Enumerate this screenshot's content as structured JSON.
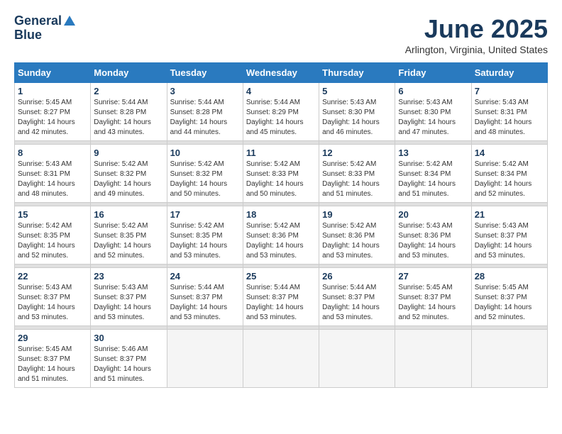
{
  "header": {
    "logo_line1": "General",
    "logo_line2": "Blue",
    "month": "June 2025",
    "location": "Arlington, Virginia, United States"
  },
  "days_of_week": [
    "Sunday",
    "Monday",
    "Tuesday",
    "Wednesday",
    "Thursday",
    "Friday",
    "Saturday"
  ],
  "weeks": [
    [
      {
        "day": "1",
        "sunrise": "5:45 AM",
        "sunset": "8:27 PM",
        "daylight": "14 hours and 42 minutes."
      },
      {
        "day": "2",
        "sunrise": "5:44 AM",
        "sunset": "8:28 PM",
        "daylight": "14 hours and 43 minutes."
      },
      {
        "day": "3",
        "sunrise": "5:44 AM",
        "sunset": "8:28 PM",
        "daylight": "14 hours and 44 minutes."
      },
      {
        "day": "4",
        "sunrise": "5:44 AM",
        "sunset": "8:29 PM",
        "daylight": "14 hours and 45 minutes."
      },
      {
        "day": "5",
        "sunrise": "5:43 AM",
        "sunset": "8:30 PM",
        "daylight": "14 hours and 46 minutes."
      },
      {
        "day": "6",
        "sunrise": "5:43 AM",
        "sunset": "8:30 PM",
        "daylight": "14 hours and 47 minutes."
      },
      {
        "day": "7",
        "sunrise": "5:43 AM",
        "sunset": "8:31 PM",
        "daylight": "14 hours and 48 minutes."
      }
    ],
    [
      {
        "day": "8",
        "sunrise": "5:43 AM",
        "sunset": "8:31 PM",
        "daylight": "14 hours and 48 minutes."
      },
      {
        "day": "9",
        "sunrise": "5:42 AM",
        "sunset": "8:32 PM",
        "daylight": "14 hours and 49 minutes."
      },
      {
        "day": "10",
        "sunrise": "5:42 AM",
        "sunset": "8:32 PM",
        "daylight": "14 hours and 50 minutes."
      },
      {
        "day": "11",
        "sunrise": "5:42 AM",
        "sunset": "8:33 PM",
        "daylight": "14 hours and 50 minutes."
      },
      {
        "day": "12",
        "sunrise": "5:42 AM",
        "sunset": "8:33 PM",
        "daylight": "14 hours and 51 minutes."
      },
      {
        "day": "13",
        "sunrise": "5:42 AM",
        "sunset": "8:34 PM",
        "daylight": "14 hours and 51 minutes."
      },
      {
        "day": "14",
        "sunrise": "5:42 AM",
        "sunset": "8:34 PM",
        "daylight": "14 hours and 52 minutes."
      }
    ],
    [
      {
        "day": "15",
        "sunrise": "5:42 AM",
        "sunset": "8:35 PM",
        "daylight": "14 hours and 52 minutes."
      },
      {
        "day": "16",
        "sunrise": "5:42 AM",
        "sunset": "8:35 PM",
        "daylight": "14 hours and 52 minutes."
      },
      {
        "day": "17",
        "sunrise": "5:42 AM",
        "sunset": "8:35 PM",
        "daylight": "14 hours and 53 minutes."
      },
      {
        "day": "18",
        "sunrise": "5:42 AM",
        "sunset": "8:36 PM",
        "daylight": "14 hours and 53 minutes."
      },
      {
        "day": "19",
        "sunrise": "5:42 AM",
        "sunset": "8:36 PM",
        "daylight": "14 hours and 53 minutes."
      },
      {
        "day": "20",
        "sunrise": "5:43 AM",
        "sunset": "8:36 PM",
        "daylight": "14 hours and 53 minutes."
      },
      {
        "day": "21",
        "sunrise": "5:43 AM",
        "sunset": "8:37 PM",
        "daylight": "14 hours and 53 minutes."
      }
    ],
    [
      {
        "day": "22",
        "sunrise": "5:43 AM",
        "sunset": "8:37 PM",
        "daylight": "14 hours and 53 minutes."
      },
      {
        "day": "23",
        "sunrise": "5:43 AM",
        "sunset": "8:37 PM",
        "daylight": "14 hours and 53 minutes."
      },
      {
        "day": "24",
        "sunrise": "5:44 AM",
        "sunset": "8:37 PM",
        "daylight": "14 hours and 53 minutes."
      },
      {
        "day": "25",
        "sunrise": "5:44 AM",
        "sunset": "8:37 PM",
        "daylight": "14 hours and 53 minutes."
      },
      {
        "day": "26",
        "sunrise": "5:44 AM",
        "sunset": "8:37 PM",
        "daylight": "14 hours and 53 minutes."
      },
      {
        "day": "27",
        "sunrise": "5:45 AM",
        "sunset": "8:37 PM",
        "daylight": "14 hours and 52 minutes."
      },
      {
        "day": "28",
        "sunrise": "5:45 AM",
        "sunset": "8:37 PM",
        "daylight": "14 hours and 52 minutes."
      }
    ],
    [
      {
        "day": "29",
        "sunrise": "5:45 AM",
        "sunset": "8:37 PM",
        "daylight": "14 hours and 51 minutes."
      },
      {
        "day": "30",
        "sunrise": "5:46 AM",
        "sunset": "8:37 PM",
        "daylight": "14 hours and 51 minutes."
      },
      null,
      null,
      null,
      null,
      null
    ]
  ],
  "labels": {
    "sunrise": "Sunrise:",
    "sunset": "Sunset:",
    "daylight": "Daylight:"
  }
}
